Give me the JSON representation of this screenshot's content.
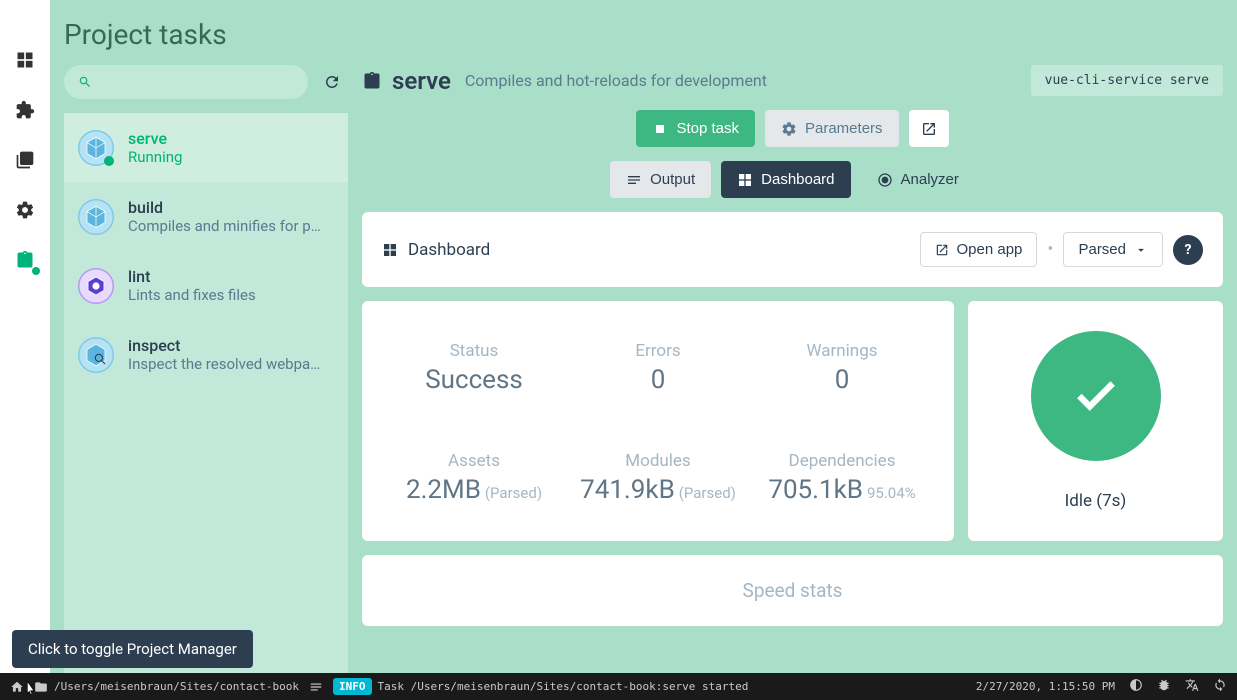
{
  "page_title": "Project tasks",
  "tasks": [
    {
      "name": "serve",
      "desc": "Running",
      "active": true
    },
    {
      "name": "build",
      "desc": "Compiles and minifies for p…"
    },
    {
      "name": "lint",
      "desc": "Lints and fixes files"
    },
    {
      "name": "inspect",
      "desc": "Inspect the resolved webpa…"
    }
  ],
  "main": {
    "name": "serve",
    "desc": "Compiles and hot-reloads for development",
    "cmd": "vue-cli-service serve"
  },
  "actions": {
    "stop": "Stop task",
    "params": "Parameters"
  },
  "tabs": {
    "output": "Output",
    "dashboard": "Dashboard",
    "analyzer": "Analyzer"
  },
  "dashboard": {
    "title": "Dashboard",
    "open_app": "Open app",
    "parsed": "Parsed",
    "stats": {
      "status_label": "Status",
      "status_value": "Success",
      "errors_label": "Errors",
      "errors_value": "0",
      "warnings_label": "Warnings",
      "warnings_value": "0",
      "assets_label": "Assets",
      "assets_value": "2.2MB",
      "assets_sub": "(Parsed)",
      "modules_label": "Modules",
      "modules_value": "741.9kB",
      "modules_sub": "(Parsed)",
      "deps_label": "Dependencies",
      "deps_value": "705.1kB",
      "deps_sub": "95.04%"
    },
    "status_text": "Idle (7s)",
    "speed_title": "Speed stats"
  },
  "tooltip": "Click to toggle Project Manager",
  "bottom": {
    "path": "/Users/meisenbraun/Sites/contact-book",
    "badge": "INFO",
    "msg": "Task /Users/meisenbraun/Sites/contact-book:serve started",
    "time": "2/27/2020, 1:15:50 PM"
  }
}
